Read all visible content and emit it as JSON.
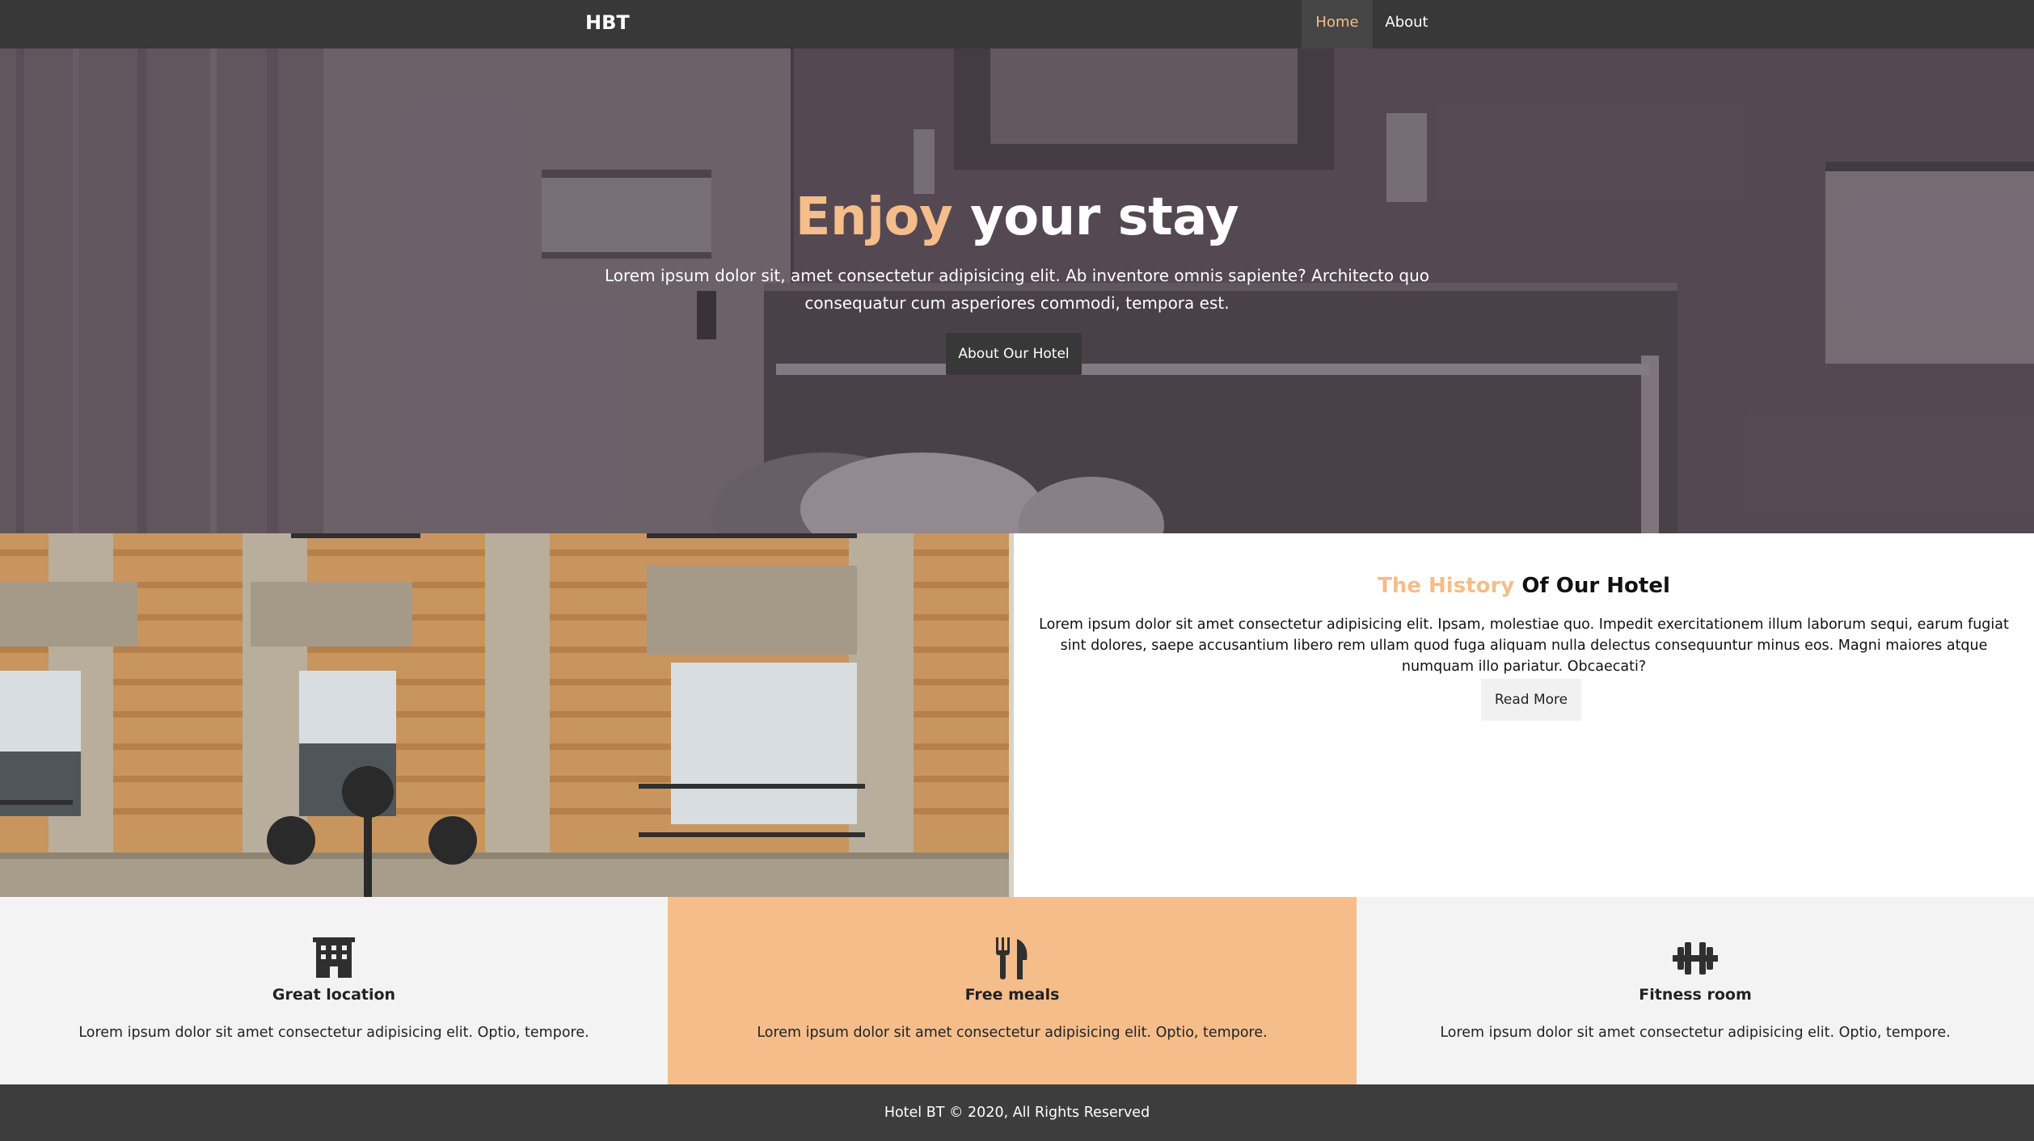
{
  "navbar": {
    "brand": "HBT",
    "items": [
      {
        "label": "Home",
        "active": true
      },
      {
        "label": "About",
        "active": false
      }
    ]
  },
  "hero": {
    "title_accent": "Enjoy",
    "title_rest": "your stay",
    "text": "Lorem ipsum dolor sit, amet consectetur adipisicing elit. Ab inventore omnis sapiente? Architecto quo consequatur cum asperiores commodi, tempora est.",
    "button_label": "About Our Hotel"
  },
  "history": {
    "title_accent": "The History",
    "title_rest": "Of Our Hotel",
    "text": "Lorem ipsum dolor sit amet consectetur adipisicing elit. Ipsam, molestiae quo. Impedit exercitationem illum laborum sequi, earum fugiat sint dolores, saepe accusantium libero rem ullam quod fuga aliquam nulla delectus consequuntur minus eos. Magni maiores atque numquam illo pariatur. Obcaecati?",
    "button_label": "Read More"
  },
  "features": [
    {
      "icon": "building-icon",
      "title": "Great location",
      "text": "Lorem ipsum dolor sit amet consectetur adipisicing elit. Optio, tempore."
    },
    {
      "icon": "utensils-icon",
      "title": "Free meals",
      "text": "Lorem ipsum dolor sit amet consectetur adipisicing elit. Optio, tempore."
    },
    {
      "icon": "dumbbell-icon",
      "title": "Fitness room",
      "text": "Lorem ipsum dolor sit amet consectetur adipisicing elit. Optio, tempore."
    }
  ],
  "footer": {
    "text": "Hotel BT © 2020, All Rights Reserved"
  },
  "colors": {
    "accent": "#f5bd8a",
    "dark": "#383838",
    "light_gray": "#f3f3f3"
  }
}
